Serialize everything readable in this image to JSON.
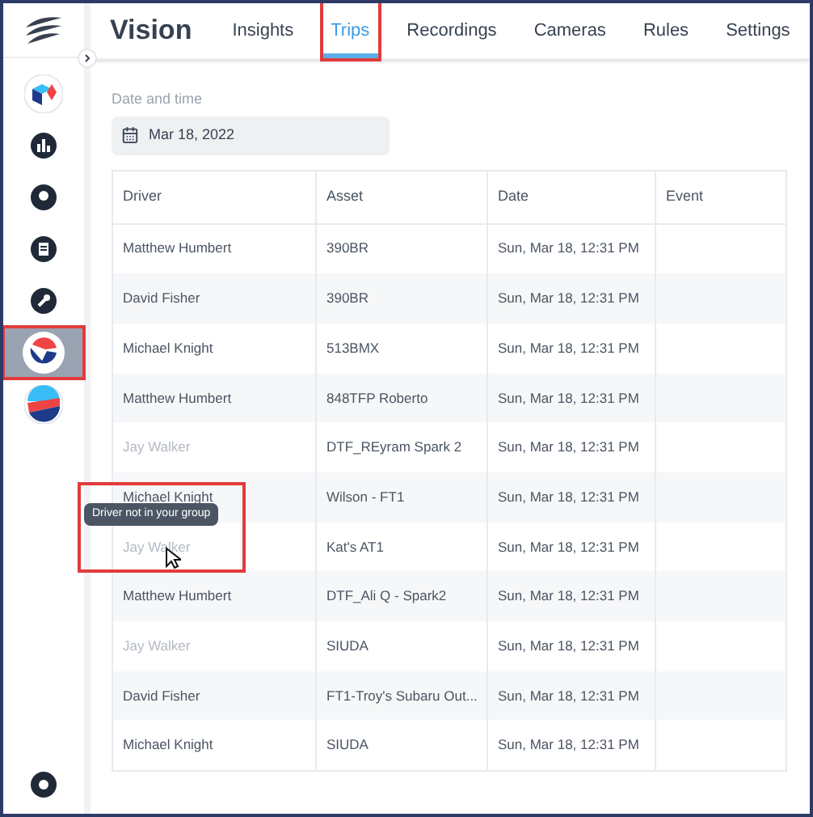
{
  "app": {
    "title": "Vision"
  },
  "tabs": [
    {
      "label": "Insights",
      "selected": false
    },
    {
      "label": "Trips",
      "selected": true
    },
    {
      "label": "Recordings",
      "selected": false
    },
    {
      "label": "Cameras",
      "selected": false
    },
    {
      "label": "Rules",
      "selected": false
    },
    {
      "label": "Settings",
      "selected": false
    }
  ],
  "sidebar": {
    "items": [
      {
        "selected": false
      },
      {
        "selected": false
      },
      {
        "selected": false
      },
      {
        "selected": false
      },
      {
        "selected": false
      },
      {
        "selected": true
      },
      {
        "selected": false
      }
    ]
  },
  "date_filter": {
    "label": "Date and time",
    "value": "Mar 18, 2022"
  },
  "table": {
    "columns": [
      "Driver",
      "Asset",
      "Date",
      "Event"
    ],
    "rows": [
      {
        "driver": "Matthew Humbert",
        "asset": "390BR",
        "date": "Sun, Mar 18, 12:31 PM",
        "dimmed": false
      },
      {
        "driver": "David Fisher",
        "asset": "390BR",
        "date": "Sun, Mar 18, 12:31 PM",
        "dimmed": false
      },
      {
        "driver": "Michael Knight",
        "asset": "513BMX",
        "date": "Sun, Mar 18, 12:31 PM",
        "dimmed": false
      },
      {
        "driver": "Matthew Humbert",
        "asset": "848TFP Roberto",
        "date": "Sun, Mar 18, 12:31 PM",
        "dimmed": false
      },
      {
        "driver": "Jay Walker",
        "asset": "DTF_REyram Spark 2",
        "date": "Sun, Mar 18, 12:31 PM",
        "dimmed": true
      },
      {
        "driver": "Michael Knight",
        "asset": "Wilson - FT1",
        "date": "Sun, Mar 18, 12:31 PM",
        "dimmed": false
      },
      {
        "driver": "Jay Walker",
        "asset": "Kat's AT1",
        "date": "Sun, Mar 18, 12:31 PM",
        "dimmed": true
      },
      {
        "driver": "Matthew Humbert",
        "asset": "DTF_Ali Q - Spark2",
        "date": "Sun, Mar 18, 12:31 PM",
        "dimmed": false
      },
      {
        "driver": "Jay Walker",
        "asset": "SIUDA",
        "date": "Sun, Mar 18, 12:31 PM",
        "dimmed": true
      },
      {
        "driver": "David Fisher",
        "asset": "FT1-Troy's Subaru Out...",
        "date": "Sun, Mar 18, 12:31 PM",
        "dimmed": false
      },
      {
        "driver": "Michael Knight",
        "asset": "SIUDA",
        "date": "Sun, Mar 18, 12:31 PM",
        "dimmed": false
      }
    ]
  },
  "tooltip": {
    "text": "Driver not in your group"
  }
}
